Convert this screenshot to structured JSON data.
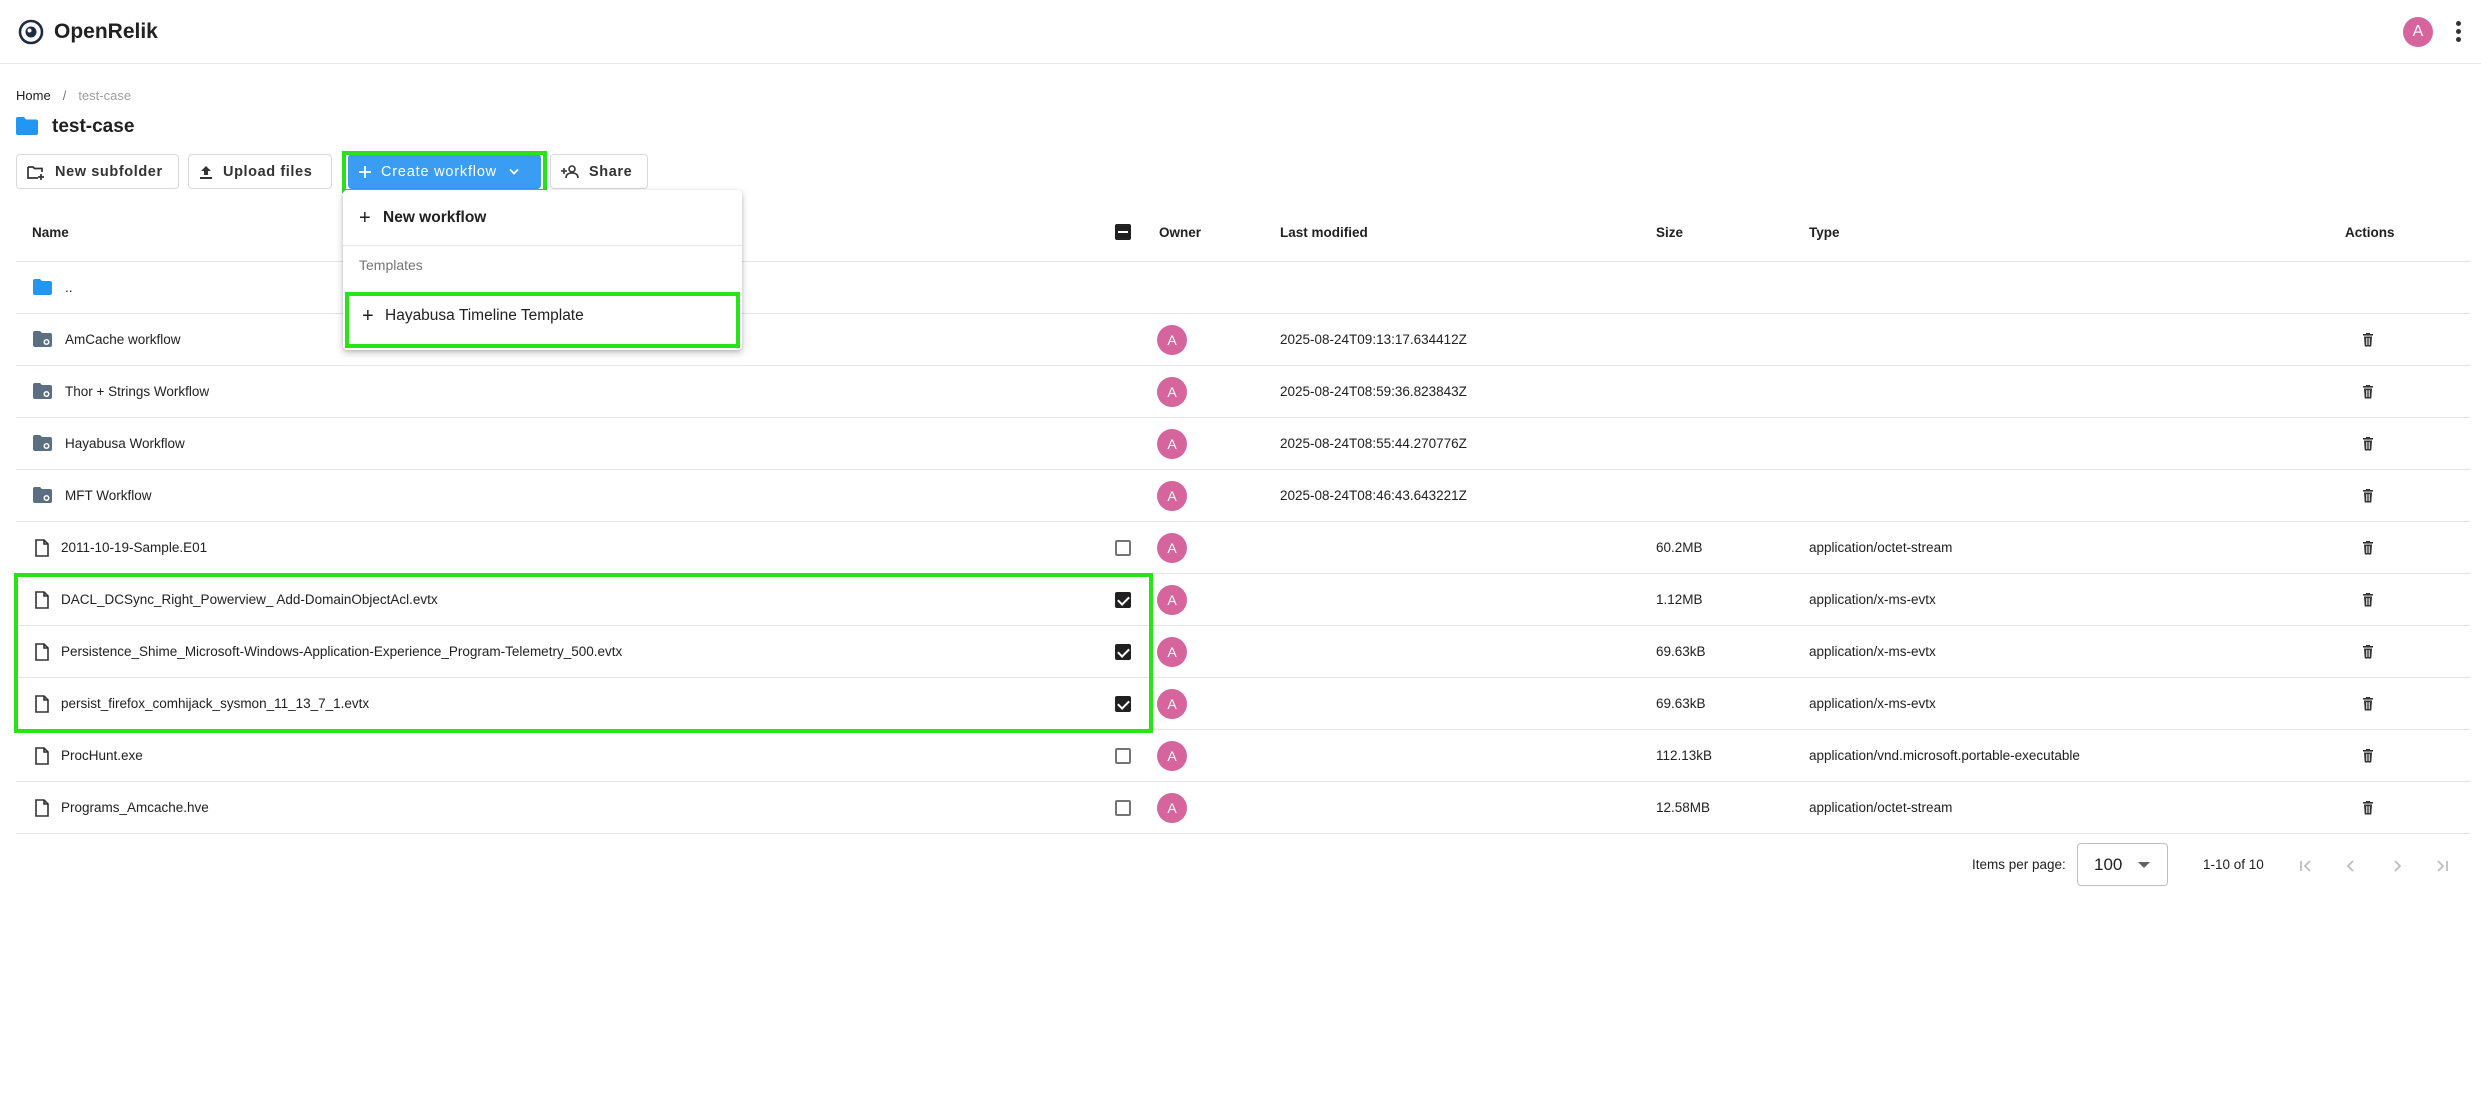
{
  "app": {
    "title": "OpenRelik",
    "user_initial": "A"
  },
  "breadcrumb": {
    "home": "Home",
    "separator": "/",
    "current": "test-case"
  },
  "folder": {
    "title": "test-case"
  },
  "toolbar": {
    "new_subfolder": "New subfolder",
    "upload_files": "Upload files",
    "create_workflow": "Create workflow",
    "share": "Share"
  },
  "menu": {
    "new_workflow": "New workflow",
    "section_label": "Templates",
    "templates": [
      "Hayabusa Timeline Template"
    ]
  },
  "table": {
    "headers": {
      "name": "Name",
      "owner": "Owner",
      "last_modified": "Last modified",
      "size": "Size",
      "type": "Type",
      "actions": "Actions"
    },
    "rows": [
      {
        "kind": "parent",
        "name": "..",
        "owner": "",
        "modified": "",
        "size": "",
        "type": "",
        "checkbox": "none"
      },
      {
        "kind": "workflow",
        "name": "AmCache workflow",
        "owner": "A",
        "modified": "2025-08-24T09:13:17.634412Z",
        "size": "",
        "type": "",
        "checkbox": "none"
      },
      {
        "kind": "workflow",
        "name": "Thor + Strings Workflow",
        "owner": "A",
        "modified": "2025-08-24T08:59:36.823843Z",
        "size": "",
        "type": "",
        "checkbox": "none"
      },
      {
        "kind": "workflow",
        "name": "Hayabusa Workflow",
        "owner": "A",
        "modified": "2025-08-24T08:55:44.270776Z",
        "size": "",
        "type": "",
        "checkbox": "none"
      },
      {
        "kind": "workflow",
        "name": "MFT Workflow",
        "owner": "A",
        "modified": "2025-08-24T08:46:43.643221Z",
        "size": "",
        "type": "",
        "checkbox": "none"
      },
      {
        "kind": "file",
        "name": "2011-10-19-Sample.E01",
        "owner": "A",
        "modified": "",
        "size": "60.2MB",
        "type": "application/octet-stream",
        "checkbox": "unchecked"
      },
      {
        "kind": "file",
        "name": "DACL_DCSync_Right_Powerview_ Add-DomainObjectAcl.evtx",
        "owner": "A",
        "modified": "",
        "size": "1.12MB",
        "type": "application/x-ms-evtx",
        "checkbox": "checked"
      },
      {
        "kind": "file",
        "name": "Persistence_Shime_Microsoft-Windows-Application-Experience_Program-Telemetry_500.evtx",
        "owner": "A",
        "modified": "",
        "size": "69.63kB",
        "type": "application/x-ms-evtx",
        "checkbox": "checked"
      },
      {
        "kind": "file",
        "name": "persist_firefox_comhijack_sysmon_11_13_7_1.evtx",
        "owner": "A",
        "modified": "",
        "size": "69.63kB",
        "type": "application/x-ms-evtx",
        "checkbox": "checked"
      },
      {
        "kind": "file",
        "name": "ProcHunt.exe",
        "owner": "A",
        "modified": "",
        "size": "112.13kB",
        "type": "application/vnd.microsoft.portable-executable",
        "checkbox": "unchecked"
      },
      {
        "kind": "file",
        "name": "Programs_Amcache.hve",
        "owner": "A",
        "modified": "",
        "size": "12.58MB",
        "type": "application/octet-stream",
        "checkbox": "unchecked"
      }
    ]
  },
  "pagination": {
    "items_per_page_label": "Items per page:",
    "items_per_page": "100",
    "range": "1-10 of 10"
  },
  "colors": {
    "accent": "#3a9df3",
    "highlight": "#28e21a",
    "avatar": "#d6659e",
    "folder_icon": "#2196f3"
  }
}
